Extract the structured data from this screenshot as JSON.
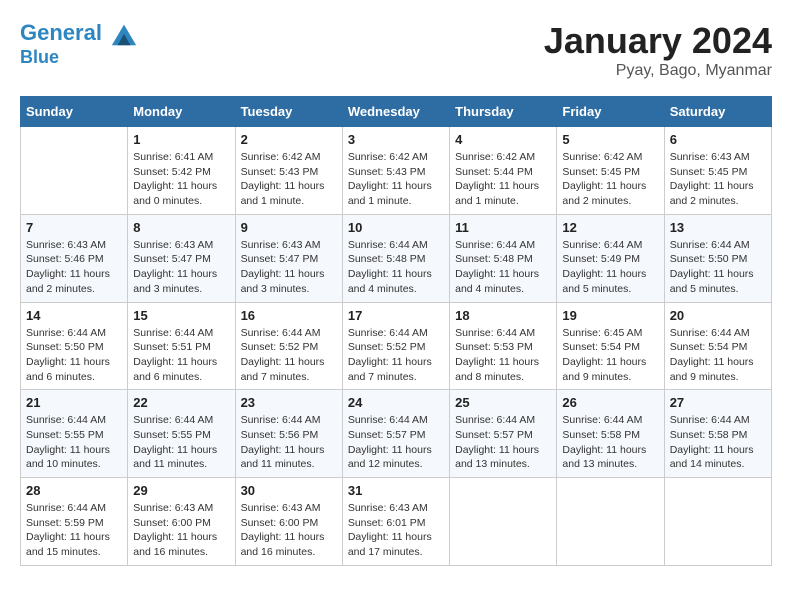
{
  "header": {
    "logo_line1": "General",
    "logo_line2": "Blue",
    "month_year": "January 2024",
    "location": "Pyay, Bago, Myanmar"
  },
  "weekdays": [
    "Sunday",
    "Monday",
    "Tuesday",
    "Wednesday",
    "Thursday",
    "Friday",
    "Saturday"
  ],
  "weeks": [
    [
      {
        "day": "",
        "sunrise": "",
        "sunset": "",
        "daylight": ""
      },
      {
        "day": "1",
        "sunrise": "Sunrise: 6:41 AM",
        "sunset": "Sunset: 5:42 PM",
        "daylight": "Daylight: 11 hours and 0 minutes."
      },
      {
        "day": "2",
        "sunrise": "Sunrise: 6:42 AM",
        "sunset": "Sunset: 5:43 PM",
        "daylight": "Daylight: 11 hours and 1 minute."
      },
      {
        "day": "3",
        "sunrise": "Sunrise: 6:42 AM",
        "sunset": "Sunset: 5:43 PM",
        "daylight": "Daylight: 11 hours and 1 minute."
      },
      {
        "day": "4",
        "sunrise": "Sunrise: 6:42 AM",
        "sunset": "Sunset: 5:44 PM",
        "daylight": "Daylight: 11 hours and 1 minute."
      },
      {
        "day": "5",
        "sunrise": "Sunrise: 6:42 AM",
        "sunset": "Sunset: 5:45 PM",
        "daylight": "Daylight: 11 hours and 2 minutes."
      },
      {
        "day": "6",
        "sunrise": "Sunrise: 6:43 AM",
        "sunset": "Sunset: 5:45 PM",
        "daylight": "Daylight: 11 hours and 2 minutes."
      }
    ],
    [
      {
        "day": "7",
        "sunrise": "Sunrise: 6:43 AM",
        "sunset": "Sunset: 5:46 PM",
        "daylight": "Daylight: 11 hours and 2 minutes."
      },
      {
        "day": "8",
        "sunrise": "Sunrise: 6:43 AM",
        "sunset": "Sunset: 5:47 PM",
        "daylight": "Daylight: 11 hours and 3 minutes."
      },
      {
        "day": "9",
        "sunrise": "Sunrise: 6:43 AM",
        "sunset": "Sunset: 5:47 PM",
        "daylight": "Daylight: 11 hours and 3 minutes."
      },
      {
        "day": "10",
        "sunrise": "Sunrise: 6:44 AM",
        "sunset": "Sunset: 5:48 PM",
        "daylight": "Daylight: 11 hours and 4 minutes."
      },
      {
        "day": "11",
        "sunrise": "Sunrise: 6:44 AM",
        "sunset": "Sunset: 5:48 PM",
        "daylight": "Daylight: 11 hours and 4 minutes."
      },
      {
        "day": "12",
        "sunrise": "Sunrise: 6:44 AM",
        "sunset": "Sunset: 5:49 PM",
        "daylight": "Daylight: 11 hours and 5 minutes."
      },
      {
        "day": "13",
        "sunrise": "Sunrise: 6:44 AM",
        "sunset": "Sunset: 5:50 PM",
        "daylight": "Daylight: 11 hours and 5 minutes."
      }
    ],
    [
      {
        "day": "14",
        "sunrise": "Sunrise: 6:44 AM",
        "sunset": "Sunset: 5:50 PM",
        "daylight": "Daylight: 11 hours and 6 minutes."
      },
      {
        "day": "15",
        "sunrise": "Sunrise: 6:44 AM",
        "sunset": "Sunset: 5:51 PM",
        "daylight": "Daylight: 11 hours and 6 minutes."
      },
      {
        "day": "16",
        "sunrise": "Sunrise: 6:44 AM",
        "sunset": "Sunset: 5:52 PM",
        "daylight": "Daylight: 11 hours and 7 minutes."
      },
      {
        "day": "17",
        "sunrise": "Sunrise: 6:44 AM",
        "sunset": "Sunset: 5:52 PM",
        "daylight": "Daylight: 11 hours and 7 minutes."
      },
      {
        "day": "18",
        "sunrise": "Sunrise: 6:44 AM",
        "sunset": "Sunset: 5:53 PM",
        "daylight": "Daylight: 11 hours and 8 minutes."
      },
      {
        "day": "19",
        "sunrise": "Sunrise: 6:45 AM",
        "sunset": "Sunset: 5:54 PM",
        "daylight": "Daylight: 11 hours and 9 minutes."
      },
      {
        "day": "20",
        "sunrise": "Sunrise: 6:44 AM",
        "sunset": "Sunset: 5:54 PM",
        "daylight": "Daylight: 11 hours and 9 minutes."
      }
    ],
    [
      {
        "day": "21",
        "sunrise": "Sunrise: 6:44 AM",
        "sunset": "Sunset: 5:55 PM",
        "daylight": "Daylight: 11 hours and 10 minutes."
      },
      {
        "day": "22",
        "sunrise": "Sunrise: 6:44 AM",
        "sunset": "Sunset: 5:55 PM",
        "daylight": "Daylight: 11 hours and 11 minutes."
      },
      {
        "day": "23",
        "sunrise": "Sunrise: 6:44 AM",
        "sunset": "Sunset: 5:56 PM",
        "daylight": "Daylight: 11 hours and 11 minutes."
      },
      {
        "day": "24",
        "sunrise": "Sunrise: 6:44 AM",
        "sunset": "Sunset: 5:57 PM",
        "daylight": "Daylight: 11 hours and 12 minutes."
      },
      {
        "day": "25",
        "sunrise": "Sunrise: 6:44 AM",
        "sunset": "Sunset: 5:57 PM",
        "daylight": "Daylight: 11 hours and 13 minutes."
      },
      {
        "day": "26",
        "sunrise": "Sunrise: 6:44 AM",
        "sunset": "Sunset: 5:58 PM",
        "daylight": "Daylight: 11 hours and 13 minutes."
      },
      {
        "day": "27",
        "sunrise": "Sunrise: 6:44 AM",
        "sunset": "Sunset: 5:58 PM",
        "daylight": "Daylight: 11 hours and 14 minutes."
      }
    ],
    [
      {
        "day": "28",
        "sunrise": "Sunrise: 6:44 AM",
        "sunset": "Sunset: 5:59 PM",
        "daylight": "Daylight: 11 hours and 15 minutes."
      },
      {
        "day": "29",
        "sunrise": "Sunrise: 6:43 AM",
        "sunset": "Sunset: 6:00 PM",
        "daylight": "Daylight: 11 hours and 16 minutes."
      },
      {
        "day": "30",
        "sunrise": "Sunrise: 6:43 AM",
        "sunset": "Sunset: 6:00 PM",
        "daylight": "Daylight: 11 hours and 16 minutes."
      },
      {
        "day": "31",
        "sunrise": "Sunrise: 6:43 AM",
        "sunset": "Sunset: 6:01 PM",
        "daylight": "Daylight: 11 hours and 17 minutes."
      },
      {
        "day": "",
        "sunrise": "",
        "sunset": "",
        "daylight": ""
      },
      {
        "day": "",
        "sunrise": "",
        "sunset": "",
        "daylight": ""
      },
      {
        "day": "",
        "sunrise": "",
        "sunset": "",
        "daylight": ""
      }
    ]
  ]
}
